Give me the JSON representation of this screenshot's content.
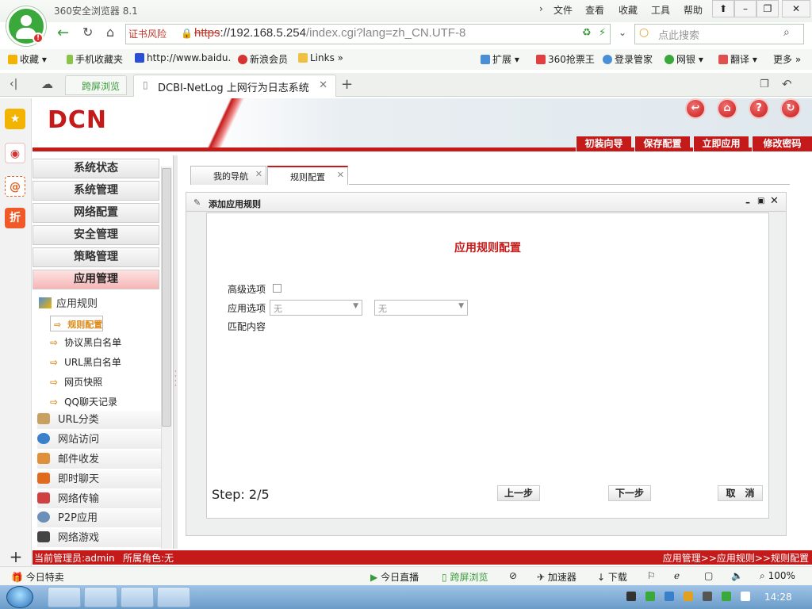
{
  "browser": {
    "app_name": "360安全浏览器 8.1",
    "menus": [
      "文件",
      "查看",
      "收藏",
      "工具",
      "帮助"
    ],
    "cert_warning": "证书风险",
    "url_scheme": "https",
    "url_host": "://192.168.5.254",
    "url_path": "/index.cgi?lang=zh_CN.UTF-8",
    "search_placeholder": "点此搜索",
    "bookmarks": [
      "收藏",
      "手机收藏夹",
      "http://www.baidu.",
      "新浪会员",
      "Links"
    ],
    "bookmarks_right": [
      "扩展",
      "360抢票王",
      "登录管家",
      "网银",
      "翻译",
      "更多"
    ],
    "tabs": {
      "split": "跨屏浏览",
      "active": "DCBI-NetLog 上网行为日志系统"
    },
    "status": {
      "left": "今日特卖",
      "items": [
        "今日直播",
        "跨屏浏览",
        "加速器",
        "下载"
      ],
      "zoom": "100%"
    }
  },
  "header": {
    "logo": "DCN",
    "actions": [
      "初装向导",
      "保存配置",
      "立即应用",
      "修改密码"
    ]
  },
  "nav": {
    "categories": [
      "系统状态",
      "系统管理",
      "网络配置",
      "安全管理",
      "策略管理",
      "应用管理"
    ],
    "active_group": "应用规则",
    "leaves": [
      "规则配置",
      "协议黑白名单",
      "URL黑白名单",
      "网页快照",
      "QQ聊天记录"
    ],
    "modules": [
      "URL分类",
      "网站访问",
      "邮件收发",
      "即时聊天",
      "网络传输",
      "P2P应用",
      "网络游戏"
    ]
  },
  "page_tabs": [
    "我的导航",
    "规则配置"
  ],
  "panel": {
    "title": "添加应用规则",
    "form_title": "应用规则配置",
    "advanced_label": "高级选项",
    "app_option_label": "应用选项",
    "select1": "无",
    "select2": "无",
    "match_label": "匹配内容",
    "step": "Step: 2/5",
    "prev": "上一步",
    "next": "下一步",
    "cancel": "取　消"
  },
  "app_status": {
    "admin": "当前管理员:admin",
    "role": "所属角色:无",
    "breadcrumb": "应用管理>>应用规则>>规则配置"
  },
  "taskbar": {
    "time": "14:28"
  }
}
